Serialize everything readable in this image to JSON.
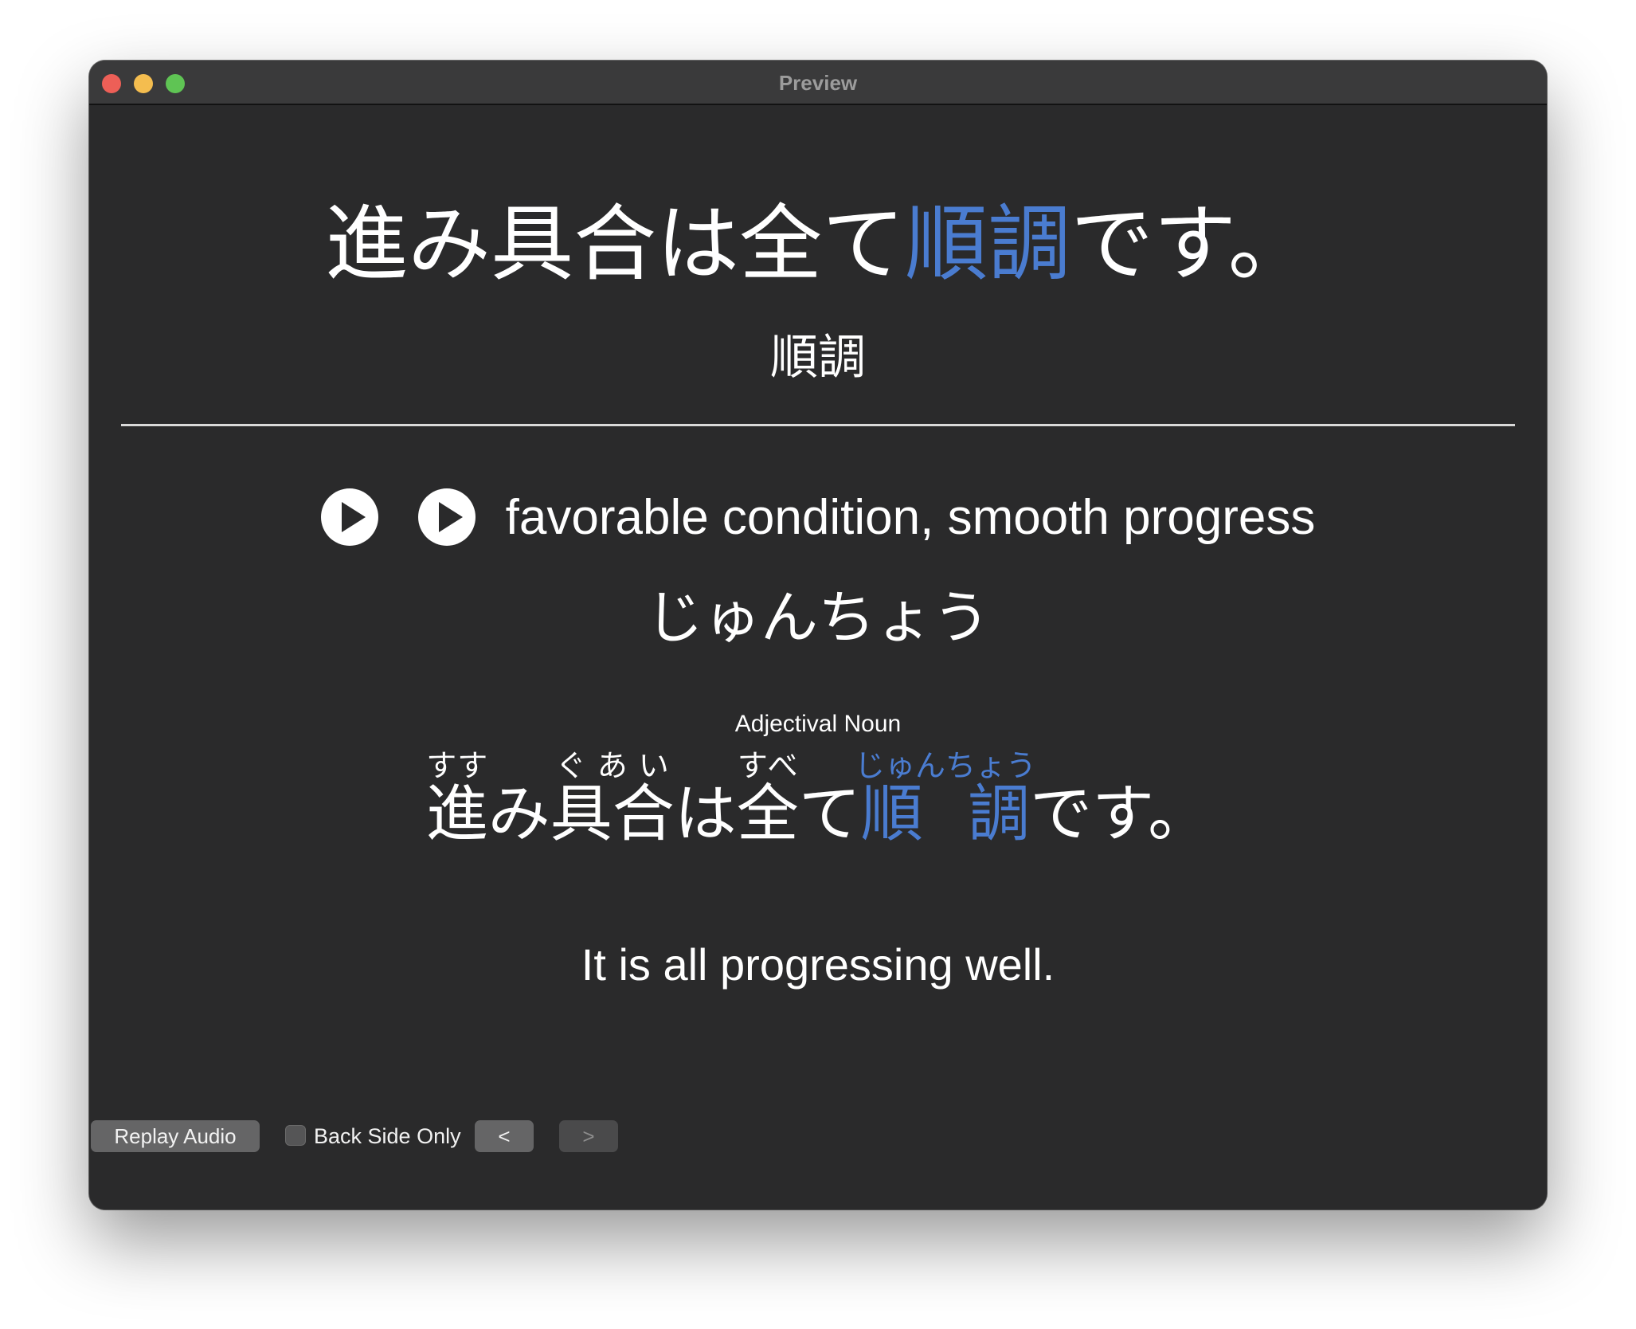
{
  "window": {
    "title": "Preview"
  },
  "card": {
    "front": {
      "sentence_before": "進み具合は全て",
      "sentence_highlight": "順調",
      "sentence_after": "です。",
      "word": "順調"
    },
    "back": {
      "meaning": "favorable condition, smooth progress",
      "reading": "じゅんちょう",
      "part_of_speech": "Adjectival Noun",
      "furigana_sentence": [
        {
          "base": "進",
          "ruby": "すす",
          "highlight": false
        },
        {
          "base": "み",
          "ruby": "",
          "highlight": false
        },
        {
          "base": "具合",
          "ruby": "ぐあい",
          "highlight": false
        },
        {
          "base": "は",
          "ruby": "",
          "highlight": false
        },
        {
          "base": "全",
          "ruby": "すべ",
          "highlight": false
        },
        {
          "base": "て",
          "ruby": "",
          "highlight": false
        },
        {
          "base": "順 調",
          "ruby": "じゅんちょう",
          "highlight": true
        },
        {
          "base": "です。",
          "ruby": "",
          "highlight": false
        }
      ],
      "translation": "It is all progressing well."
    }
  },
  "toolbar": {
    "replay_label": "Replay Audio",
    "back_side_only_label": "Back Side Only",
    "back_side_only_checked": false,
    "prev_label": "<",
    "next_label": ">"
  },
  "colors": {
    "accent": "#4a7cd0",
    "background": "#2a2a2b",
    "text": "#ffffff"
  }
}
